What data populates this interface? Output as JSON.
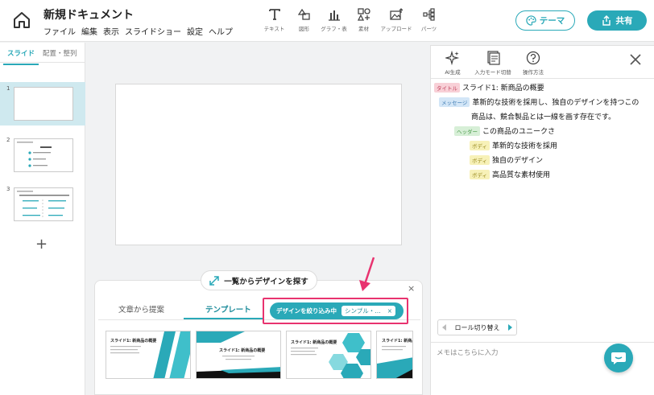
{
  "header": {
    "doc_title": "新規ドキュメント",
    "menu": [
      "ファイル",
      "編集",
      "表示",
      "スライドショー",
      "設定",
      "ヘルプ"
    ],
    "tools": [
      {
        "label": "テキスト",
        "icon": "text-icon"
      },
      {
        "label": "図形",
        "icon": "shape-icon"
      },
      {
        "label": "グラフ・表",
        "icon": "chart-icon"
      },
      {
        "label": "素材",
        "icon": "material-icon"
      },
      {
        "label": "アップロード",
        "icon": "upload-icon"
      },
      {
        "label": "パーツ",
        "icon": "parts-icon"
      }
    ],
    "theme_label": "テーマ",
    "share_label": "共有"
  },
  "left_panel": {
    "tabs": [
      "スライド",
      "配置・整列"
    ],
    "slide_numbers": [
      "1",
      "2",
      "3"
    ],
    "add_symbol": "+"
  },
  "design_panel": {
    "find_label": "一覧からデザインを探す",
    "close_symbol": "×",
    "tabs": [
      "文章から提案",
      "テンプレート"
    ],
    "filter_label": "デザインを絞り込み中",
    "filter_chip": "シンプル・…",
    "filter_chip_close": "×",
    "template_title": "スライド1: 新商品の概要"
  },
  "right_panel": {
    "tools": [
      {
        "label": "AI生成",
        "icon": "ai-sparkle-icon"
      },
      {
        "label": "入力モード切替",
        "icon": "input-mode-icon"
      },
      {
        "label": "操作方法",
        "icon": "help-icon"
      }
    ],
    "outline": [
      {
        "tag": "タイトル",
        "type": "title",
        "text": "スライド1: 新商品の概要"
      },
      {
        "tag": "メッセージ",
        "type": "msg",
        "text": "革新的な技術を採用し、独自のデザインを持つこの"
      },
      {
        "tag": "",
        "type": "cont",
        "text": "商品は、競合製品とは一線を画す存在です。"
      },
      {
        "tag": "ヘッダー",
        "type": "hdr",
        "text": "この商品のユニークさ"
      },
      {
        "tag": "ボディ",
        "type": "body",
        "text": "革新的な技術を採用"
      },
      {
        "tag": "ボディ",
        "type": "body",
        "text": "独自のデザイン"
      },
      {
        "tag": "ボディ",
        "type": "body",
        "text": "高品質な素材使用"
      }
    ],
    "role_switch_label": "ロール切り替え",
    "memo_placeholder": "メモはこちらに入力"
  },
  "colors": {
    "accent": "#2aa9b8",
    "highlight": "#e8336f"
  }
}
